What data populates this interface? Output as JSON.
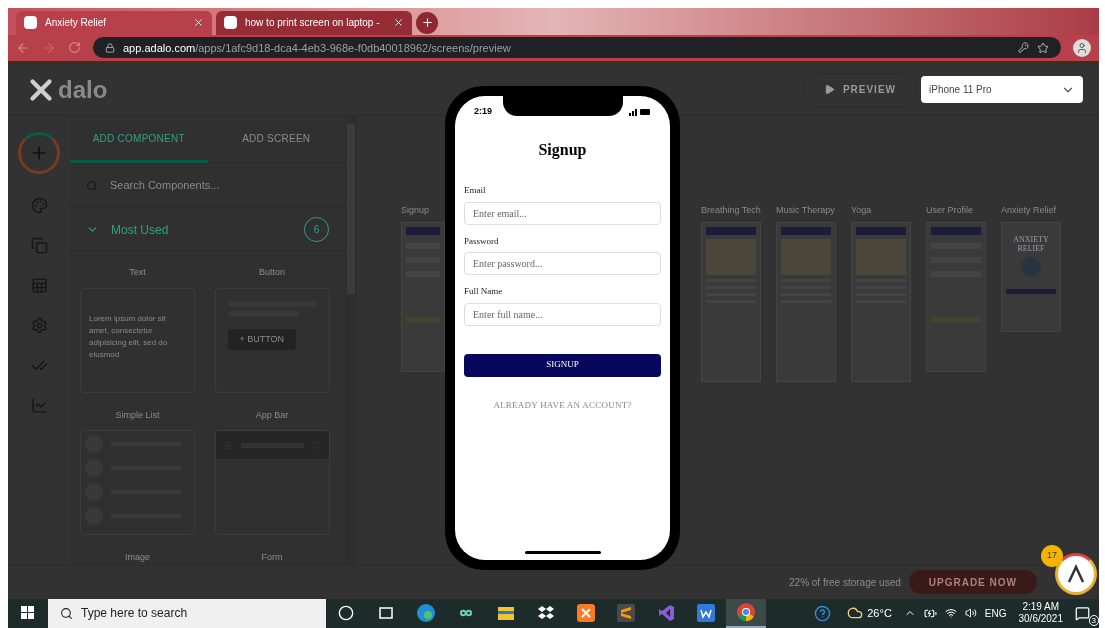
{
  "browser": {
    "tabs": [
      {
        "title": "Anxiety Relief",
        "selected": true
      },
      {
        "title": "how to print screen on laptop -",
        "selected": false
      }
    ],
    "url_host": "app.adalo.com",
    "url_path": "/apps/1afc9d18-dca4-4eb3-968e-f0db40018962/screens/preview"
  },
  "header": {
    "logo": "dalo",
    "preview_button": "PREVIEW",
    "device_select": "iPhone 11 Pro"
  },
  "panel": {
    "tabs": [
      {
        "label": "ADD COMPONENT",
        "selected": true
      },
      {
        "label": "ADD SCREEN",
        "selected": false
      }
    ],
    "search_placeholder": "Search Components...",
    "section": {
      "title": "Most Used",
      "count": "6",
      "expanded": true
    },
    "components": [
      {
        "label": "Text",
        "kind": "text",
        "sample": "Lorem ipsum dolor sit amet, consectetur adipisicing elit, sed do eiusmod"
      },
      {
        "label": "Button",
        "kind": "button",
        "sample": "+ BUTTON"
      },
      {
        "label": "Simple List",
        "kind": "list"
      },
      {
        "label": "App Bar",
        "kind": "appbar"
      },
      {
        "label": "Image",
        "kind": "partial"
      },
      {
        "label": "Form",
        "kind": "partial"
      }
    ]
  },
  "canvas": {
    "screens": [
      {
        "label": "Signup",
        "kind": "form"
      },
      {
        "label": "Breathing Tech",
        "kind": "article"
      },
      {
        "label": "Music Therapy",
        "kind": "article"
      },
      {
        "label": "Yoga",
        "kind": "article"
      },
      {
        "label": "User Profile",
        "kind": "form"
      },
      {
        "label": "Anxiety Relief",
        "kind": "splash",
        "heading": "ANXIETY RELIEF"
      }
    ]
  },
  "footer": {
    "storage": "22% of free storage used",
    "upgrade_button": "UPGRADE NOW",
    "help_badge": "17"
  },
  "phone": {
    "time": "2:19",
    "title": "Signup",
    "fields": [
      {
        "label": "Email",
        "placeholder": "Enter email..."
      },
      {
        "label": "Password",
        "placeholder": "Enter password..."
      },
      {
        "label": "Full Name",
        "placeholder": "Enter full name..."
      }
    ],
    "submit": "SIGNUP",
    "link": "ALREADY HAVE AN ACCOUNT?"
  },
  "taskbar": {
    "search_placeholder": "Type here to search",
    "apps": [
      {
        "kind": "cortana",
        "selected": false
      },
      {
        "kind": "taskview",
        "selected": false
      },
      {
        "kind": "edge",
        "selected": false
      },
      {
        "kind": "infinity",
        "selected": false
      },
      {
        "kind": "explorer",
        "selected": false
      },
      {
        "kind": "dropbox",
        "selected": false
      },
      {
        "kind": "xampp",
        "selected": false
      },
      {
        "kind": "sublime",
        "selected": false
      },
      {
        "kind": "vs",
        "selected": false
      },
      {
        "kind": "word",
        "selected": false
      },
      {
        "kind": "chrome",
        "selected": true
      }
    ],
    "temperature": "26°C",
    "language": "ENG",
    "time": "2:19 AM",
    "date": "30/6/2021",
    "notifications": "3"
  }
}
